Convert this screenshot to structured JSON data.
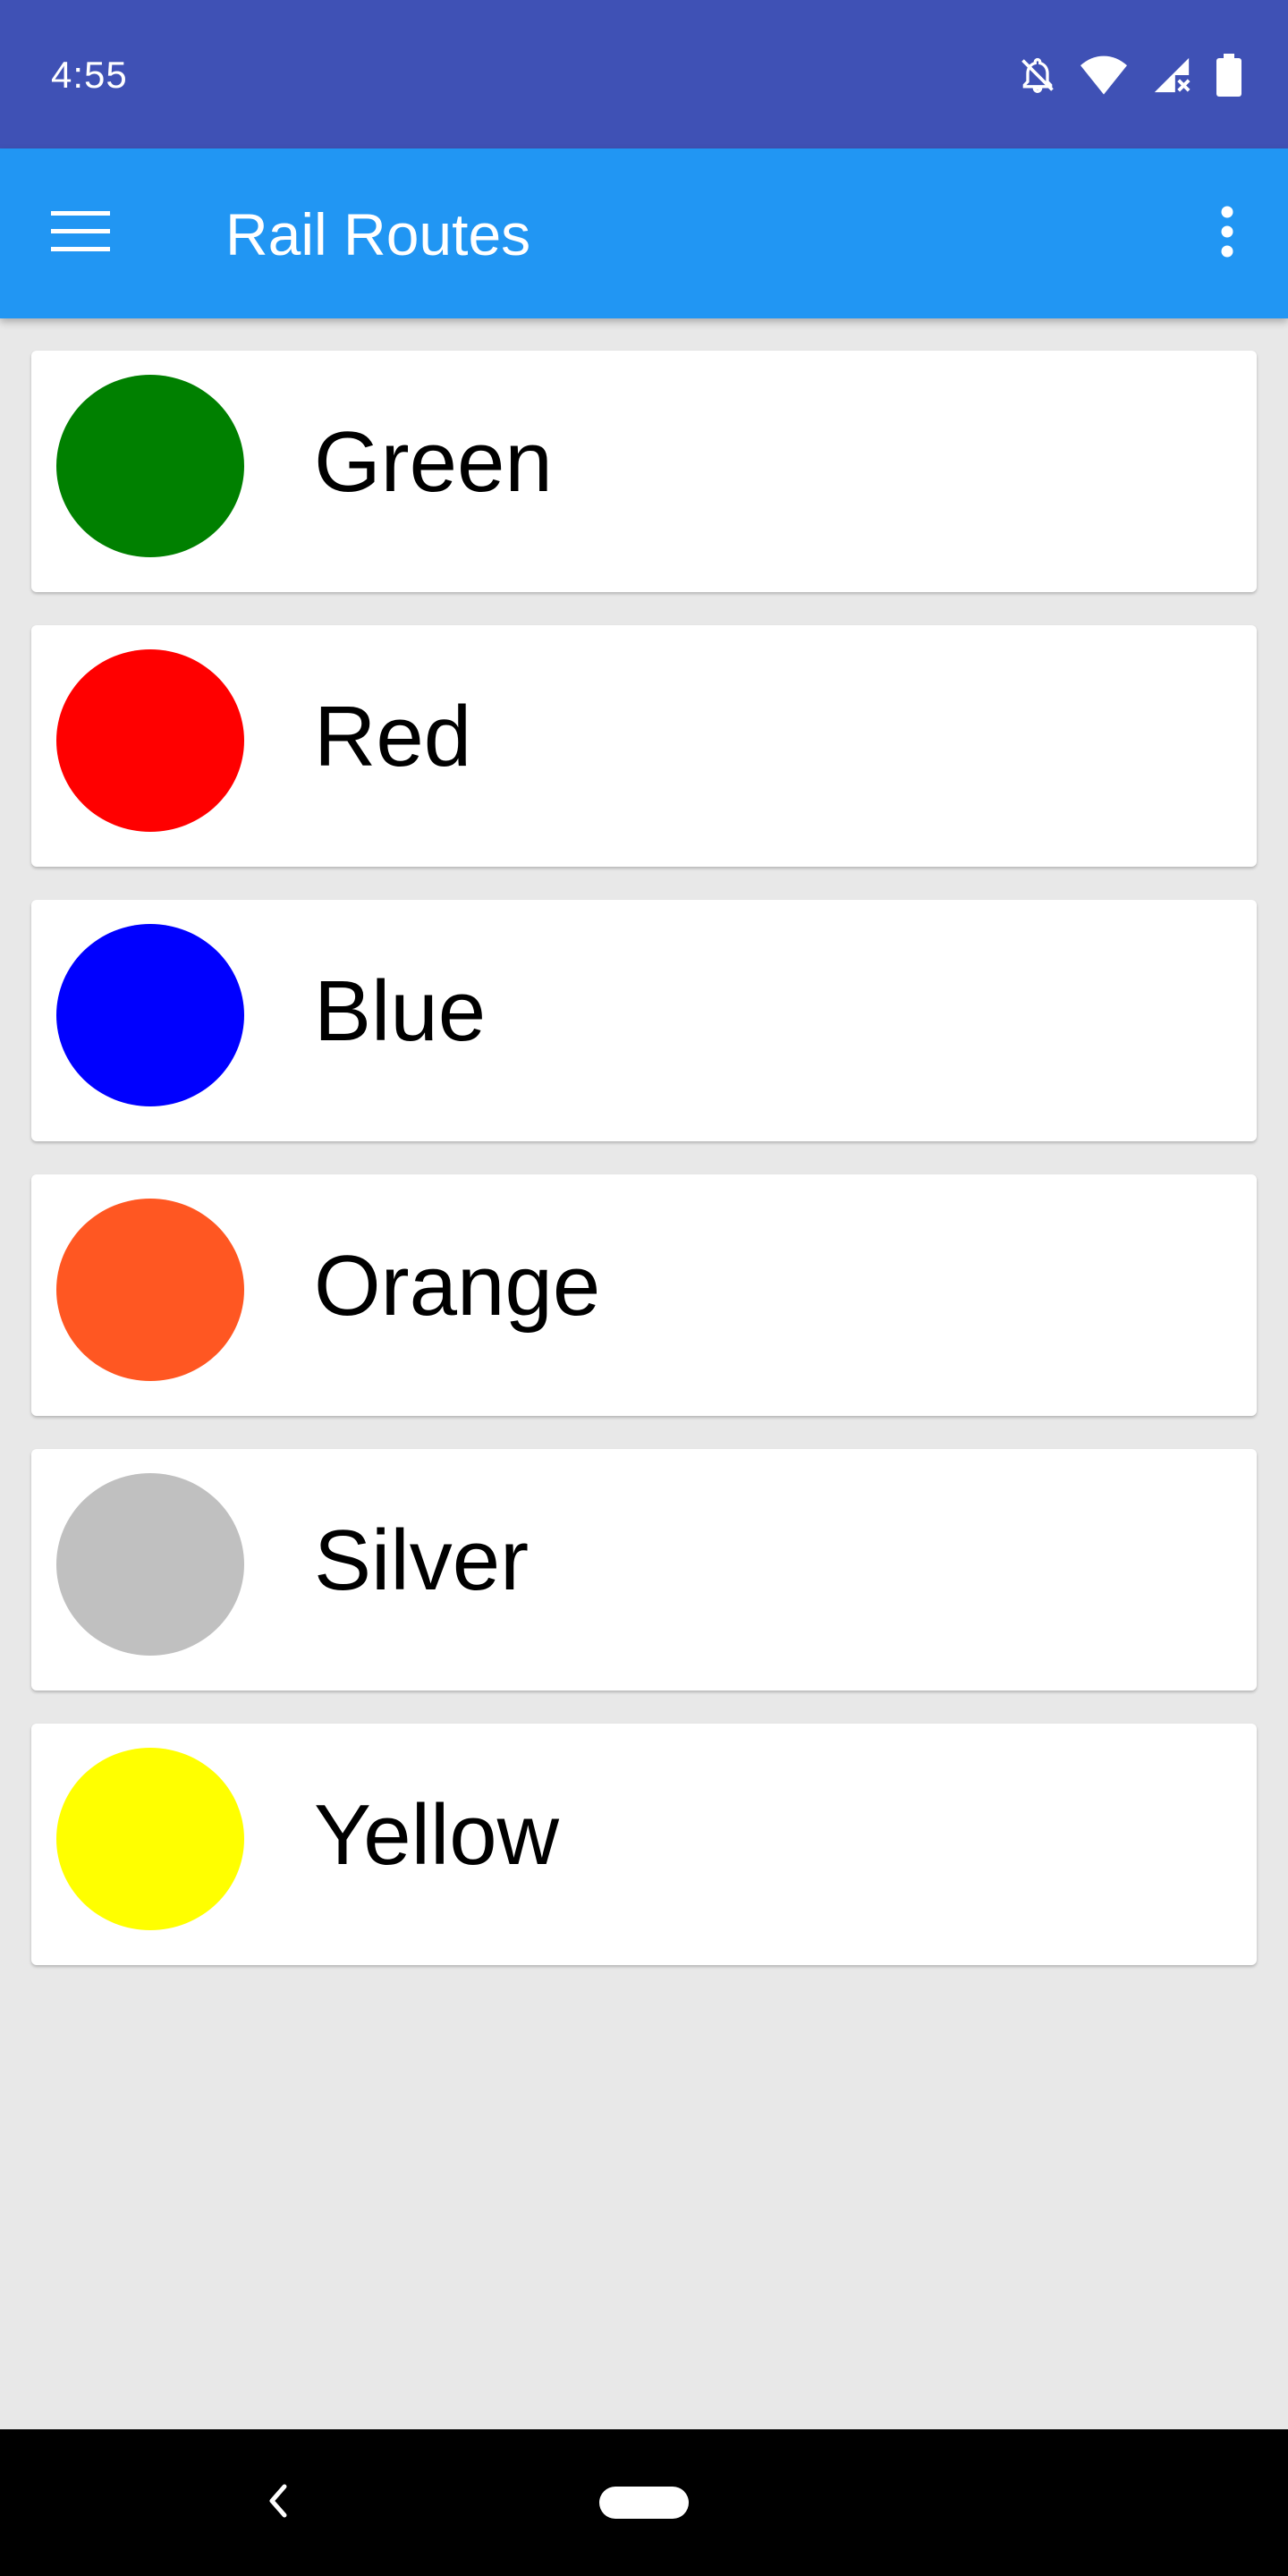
{
  "status_bar": {
    "time": "4:55",
    "background": "#3f51b5",
    "icons": [
      "notifications-off-icon",
      "wifi-icon",
      "cell-signal-icon",
      "battery-icon"
    ]
  },
  "app_bar": {
    "title": "Rail Routes",
    "background": "#2196f3",
    "icons": [
      "menu-icon",
      "overflow-menu-icon"
    ]
  },
  "routes": [
    {
      "name": "Green",
      "color": "#008000"
    },
    {
      "name": "Red",
      "color": "#ff0000"
    },
    {
      "name": "Blue",
      "color": "#0000ff"
    },
    {
      "name": "Orange",
      "color": "#ff5722"
    },
    {
      "name": "Silver",
      "color": "#c0c0c0"
    },
    {
      "name": "Yellow",
      "color": "#ffff00"
    }
  ],
  "nav_bar": {
    "icons": [
      "back-icon",
      "home-pill-icon"
    ]
  }
}
